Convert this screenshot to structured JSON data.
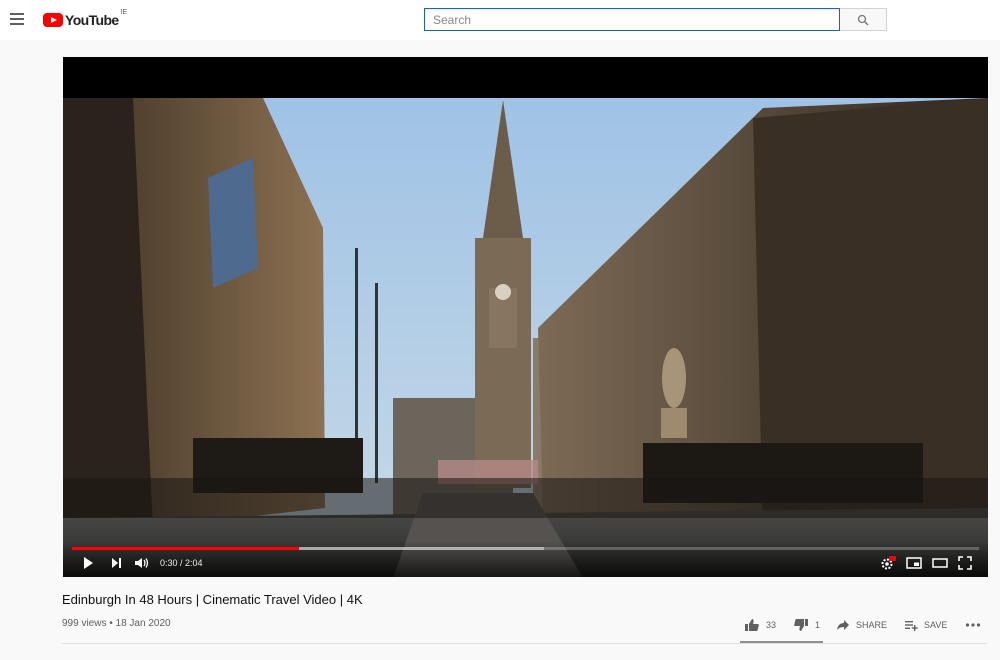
{
  "masthead": {
    "logo_text": "YouTube",
    "country_code": "IE",
    "search_placeholder": "Search",
    "icons": [
      "menu-icon",
      "search-icon"
    ]
  },
  "player": {
    "current_time": "0:30",
    "duration": "2:04",
    "time_display": "0:30 / 2:04",
    "played_fraction": 0.25,
    "buffered_fraction": 0.52,
    "accent_color": "#ff0000",
    "controls": [
      "play-icon",
      "next-icon",
      "volume-icon",
      "settings-hd-icon",
      "miniplayer-icon",
      "theater-icon",
      "fullscreen-icon"
    ]
  },
  "video": {
    "title": "Edinburgh In 48 Hours | Cinematic Travel Video | 4K",
    "meta": "999 views • 18 Jan 2020"
  },
  "actions": {
    "likes": "33",
    "dislikes": "1",
    "share_label": "SHARE",
    "save_label": "SAVE",
    "like_ratio": 0.97
  }
}
